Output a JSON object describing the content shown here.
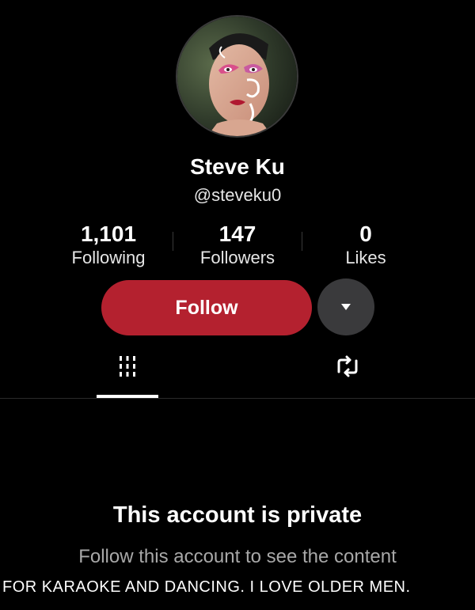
{
  "profile": {
    "display_name": "Steve Ku",
    "handle": "@steveku0",
    "avatar_icon": "profile-photo"
  },
  "stats": [
    {
      "value": "1,101",
      "label": "Following"
    },
    {
      "value": "147",
      "label": "Followers"
    },
    {
      "value": "0",
      "label": "Likes"
    }
  ],
  "actions": {
    "follow_label": "Follow",
    "dropdown_icon": "caret-down-icon",
    "follow_color": "#b4212f"
  },
  "tabs": [
    {
      "icon": "grid-icon",
      "active": true
    },
    {
      "icon": "repost-icon",
      "active": false
    }
  ],
  "private": {
    "title": "This account is private",
    "subtitle": "Follow this account to see the content"
  },
  "caption": "FOR KARAOKE AND DANCING. I LOVE OLDER MEN."
}
